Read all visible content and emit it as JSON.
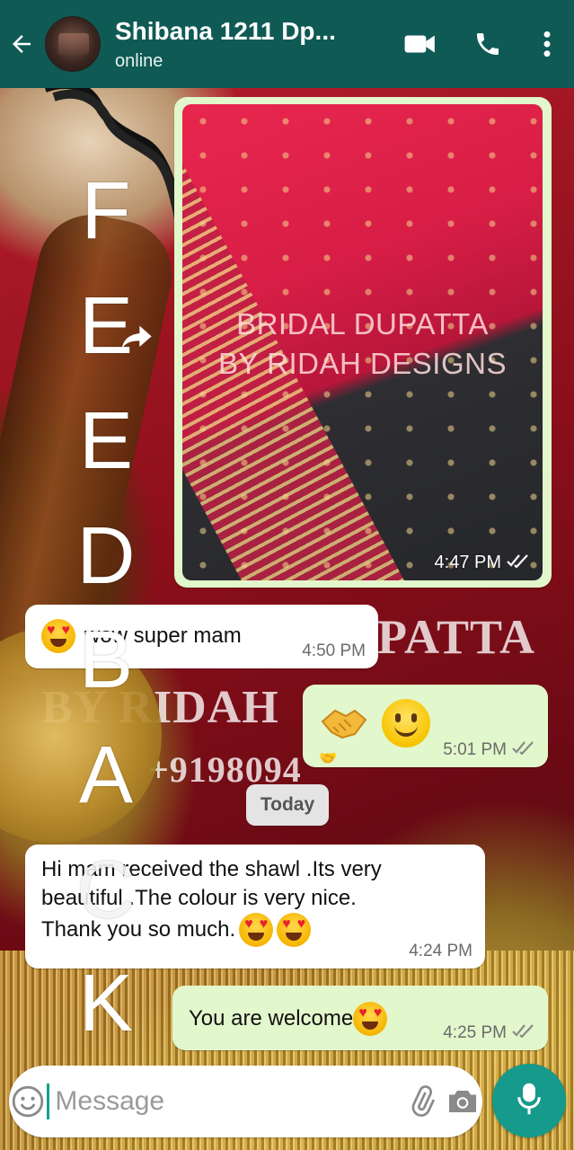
{
  "header": {
    "title": "Shibana 1211 Dp...",
    "status": "online",
    "icons": [
      "back-arrow-icon",
      "video-call-icon",
      "phone-icon",
      "more-vert-icon"
    ]
  },
  "wallpaper": {
    "overlay_line1": "PATTA",
    "overlay_line2": "BY RIDAH",
    "overlay_line3": "+9198094"
  },
  "feedback_letters": [
    "F",
    "E",
    "E",
    "D",
    "B",
    "A",
    "C",
    "K"
  ],
  "messages": {
    "image": {
      "caption_line1": "BRIDAL DUPATTA",
      "caption_line2": "BY RIDAH DESIGNS",
      "time": "4:47 PM"
    },
    "wow": {
      "text": "wow super mam",
      "time": "4:50 PM"
    },
    "emoji_reply": {
      "time": "5:01 PM"
    },
    "date_divider": "Today",
    "received": {
      "line1": "Hi mam received  the shawl .Its very",
      "line2": "beautiful .The colour is very nice.",
      "line3": "Thank  you so much.",
      "time": "4:24 PM"
    },
    "welcome": {
      "text": "You are welcome",
      "time": "4:25 PM"
    }
  },
  "input": {
    "placeholder": "Message"
  },
  "colors": {
    "header": "#0f5a55",
    "outgoing_bubble": "#e2f7cb",
    "incoming_bubble": "#ffffff",
    "mic_button": "#159a8c"
  }
}
